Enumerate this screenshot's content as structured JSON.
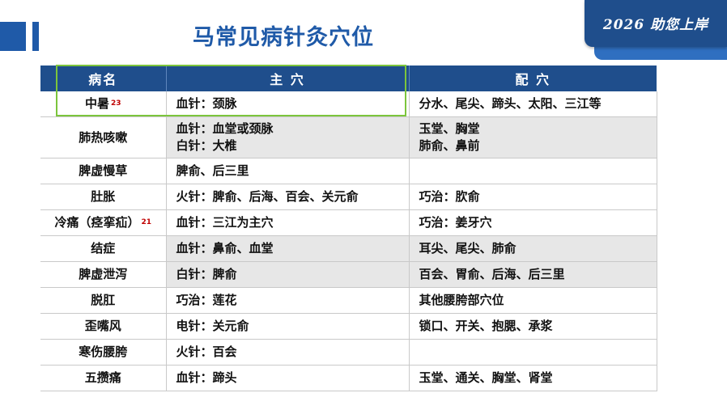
{
  "title": "马常见病针灸穴位",
  "banner": {
    "text": "2026 助您上岸"
  },
  "colors": {
    "header_bg": "#1f4e8c",
    "title": "#1f5aa8",
    "highlight": "#7cc53c",
    "gray_row": "#e7e7e7"
  },
  "table": {
    "headers": [
      "病名",
      "主 穴",
      "配 穴"
    ],
    "rows": [
      {
        "name": "中暑",
        "sup": "23",
        "main": [
          "血针：颈脉"
        ],
        "sub": [
          "分水、尾尖、蹄头、太阳、三江等"
        ],
        "gray": false
      },
      {
        "name": "肺热咳嗽",
        "sup": "",
        "main": [
          "血针：血堂或颈脉",
          "白针：大椎"
        ],
        "sub": [
          "玉堂、胸堂",
          "肺俞、鼻前"
        ],
        "gray": true
      },
      {
        "name": "脾虚慢草",
        "sup": "",
        "main": [
          "脾俞、后三里"
        ],
        "sub": [
          ""
        ],
        "gray": false
      },
      {
        "name": "肚胀",
        "sup": "",
        "main": [
          "火针：脾俞、后海、百会、关元俞"
        ],
        "sub": [
          "巧治：肷俞"
        ],
        "gray": false
      },
      {
        "name": "冷痛（痉挛疝）",
        "sup": "21",
        "main": [
          "血针：三江为主穴"
        ],
        "sub": [
          "巧治：姜牙穴"
        ],
        "gray": false
      },
      {
        "name": "结症",
        "sup": "",
        "main": [
          "血针：鼻俞、血堂"
        ],
        "sub": [
          "耳尖、尾尖、肺俞"
        ],
        "gray": true
      },
      {
        "name": "脾虚泄泻",
        "sup": "",
        "main": [
          "白针：脾俞"
        ],
        "sub": [
          "百会、胃俞、后海、后三里"
        ],
        "gray": true
      },
      {
        "name": "脱肛",
        "sup": "",
        "main": [
          "巧治：莲花"
        ],
        "sub": [
          "其他腰胯部穴位"
        ],
        "gray": false
      },
      {
        "name": "歪嘴风",
        "sup": "",
        "main": [
          "电针：关元俞"
        ],
        "sub": [
          "锁口、开关、抱腮、承浆"
        ],
        "gray": false
      },
      {
        "name": "寒伤腰胯",
        "sup": "",
        "main": [
          "火针：百会"
        ],
        "sub": [
          ""
        ],
        "gray": false
      },
      {
        "name": "五攒痛",
        "sup": "",
        "main": [
          "血针：蹄头"
        ],
        "sub": [
          "玉堂、通关、胸堂、肾堂"
        ],
        "gray": false
      }
    ]
  }
}
